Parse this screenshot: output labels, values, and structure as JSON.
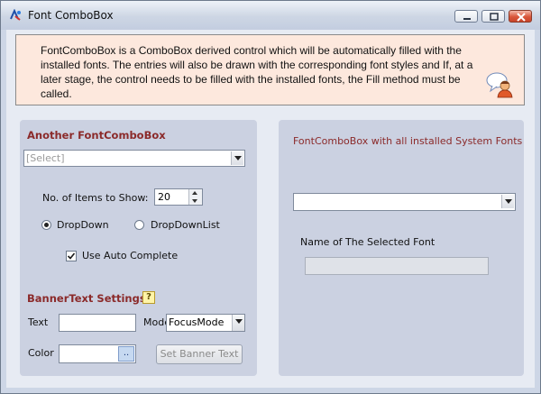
{
  "window": {
    "title": "Font ComboBox",
    "icon": "app-icon",
    "controls": [
      "minimize-icon",
      "maximize-icon",
      "close-icon"
    ]
  },
  "info": {
    "text": "FontComboBox is a ComboBox derived control which will be automatically filled with the installed fonts. The entries will also be drawn with the corresponding font styles and If, at a later stage, the control needs to be filled with the installed fonts, the Fill method must be called.",
    "icon": "help-person-icon"
  },
  "left": {
    "heading": "Another FontComboBox",
    "combo_placeholder": "[Select]",
    "items_label": "No. of Items to Show:",
    "items_value": "20",
    "radio_dropdown": "DropDown",
    "radio_dropdownlist": "DropDownList",
    "radio_selected": "DropDown",
    "autocomplete_label": "Use Auto Complete",
    "autocomplete_checked": true,
    "banner_heading": "BannerText Settings",
    "hint_icon": "?",
    "text_label": "Text",
    "text_value": "",
    "mode_label": "Mode",
    "mode_value": "FocusMode",
    "color_label": "Color",
    "color_button": "..",
    "set_banner_button": "Set Banner Text"
  },
  "right": {
    "heading": "FontComboBox with all installed System Fonts",
    "selected_font_label": "Name of The Selected Font",
    "selected_font_value": ""
  },
  "colors": {
    "heading": "#8b2a2a",
    "panel": "#cbd1e1",
    "info_background": "#fde8dd"
  }
}
